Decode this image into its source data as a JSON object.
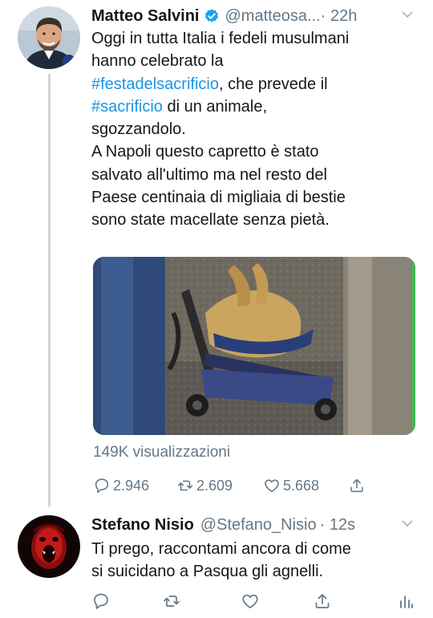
{
  "tweets": [
    {
      "author_name": "Matteo Salvini",
      "verified": true,
      "handle": "@matteosa...",
      "time": "· 22h",
      "lines": [
        [
          {
            "text": "Oggi in tutta Italia i fedeli musulmani"
          }
        ],
        [
          {
            "text": "hanno celebrato la"
          }
        ],
        [
          {
            "text": "#festadelsacrificio",
            "hashtag": true
          },
          {
            "text": ", che prevede il"
          }
        ],
        [
          {
            "text": "#sacrificio",
            "hashtag": true
          },
          {
            "text": " di un animale,"
          }
        ],
        [
          {
            "text": "sgozzandolo."
          }
        ],
        [
          {
            "text": "A Napoli questo capretto è stato"
          }
        ],
        [
          {
            "text": "salvato all'ultimo ma nel resto del"
          }
        ],
        [
          {
            "text": "Paese centinaia di migliaia di bestie"
          }
        ],
        [
          {
            "text": "sono state macellate senza pietà."
          }
        ]
      ],
      "views": "149K visualizzazioni",
      "replies": "2.946",
      "retweets": "2.609",
      "likes": "5.668"
    },
    {
      "author_name": "Stefano Nisio",
      "verified": false,
      "handle": "@Stefano_Nisio",
      "time": "· 12s",
      "lines": [
        [
          {
            "text": "Ti prego, raccontami ancora di come"
          }
        ],
        [
          {
            "text": "si suicidano a Pasqua gli agnelli."
          }
        ]
      ]
    }
  ],
  "colors": {
    "text": "#14171a",
    "secondary": "#657786",
    "link": "#1b95e0",
    "verified": "#1da1f2",
    "thread_line": "#ccd6dd"
  },
  "icons": {
    "reply": "reply-icon",
    "retweet": "retweet-icon",
    "like": "like-icon",
    "share": "share-icon",
    "analytics": "analytics-icon",
    "caret": "chevron-down-icon",
    "verified": "verified-badge-icon"
  }
}
